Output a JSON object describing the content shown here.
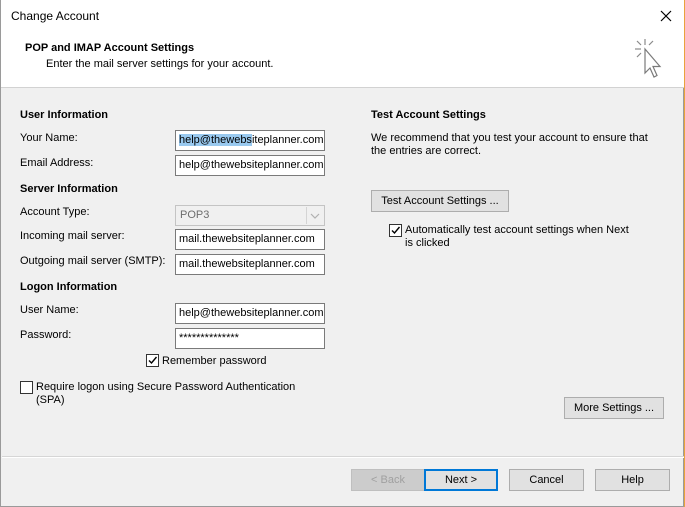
{
  "window": {
    "title": "Change Account"
  },
  "header": {
    "title": "POP and IMAP Account Settings",
    "subtitle": "Enter the mail server settings for your account."
  },
  "user_info": {
    "heading": "User Information",
    "your_name_label": "Your Name:",
    "your_name_value_selected": "help@thewebs",
    "your_name_value_rest": "iteplanner.com",
    "email_label": "Email Address:",
    "email_value": "help@thewebsiteplanner.com"
  },
  "server_info": {
    "heading": "Server Information",
    "account_type_label": "Account Type:",
    "account_type_value": "POP3",
    "incoming_label": "Incoming mail server:",
    "incoming_value": "mail.thewebsiteplanner.com",
    "outgoing_label": "Outgoing mail server (SMTP):",
    "outgoing_value": "mail.thewebsiteplanner.com"
  },
  "logon_info": {
    "heading": "Logon Information",
    "user_name_label": "User Name:",
    "user_name_value": "help@thewebsiteplanner.com",
    "password_label": "Password:",
    "password_value": "**************",
    "remember_label": "Remember password",
    "remember_checked": true,
    "spa_label_line1": "Require logon using Secure Password Authentication",
    "spa_label_line2": "(SPA)",
    "spa_checked": false
  },
  "test_settings": {
    "heading": "Test Account Settings",
    "description_line1": "We recommend that you test your account to ensure that",
    "description_line2": "the entries are correct.",
    "test_button": "Test Account Settings ...",
    "auto_test_line1": "Automatically test account settings when Next",
    "auto_test_line2": "is clicked",
    "auto_test_checked": true,
    "more_settings_button": "More Settings ..."
  },
  "footer": {
    "back_button": "< Back",
    "next_button": "Next >",
    "cancel_button": "Cancel",
    "help_button": "Help"
  },
  "colors": {
    "selection": "#99c9ef",
    "primary_border": "#0078d7",
    "window_bg": "#f0f0f0"
  }
}
